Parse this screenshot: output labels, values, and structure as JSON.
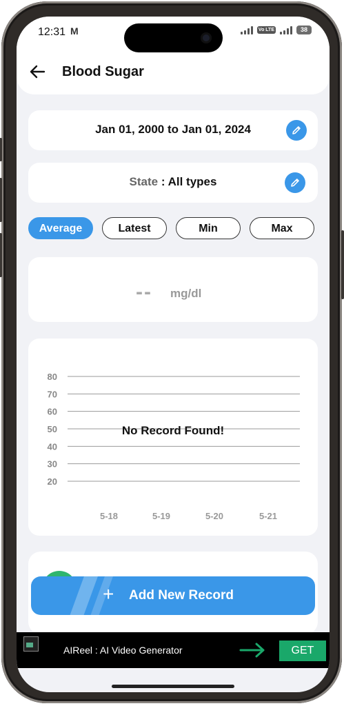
{
  "status_bar": {
    "time": "12:31",
    "mail_glyph": "M",
    "volte": "Vo LTE",
    "battery": "38"
  },
  "header": {
    "title": "Blood Sugar",
    "back_icon": "arrow-left"
  },
  "date_range": {
    "text": "Jan 01, 2000 to Jan 01, 2024",
    "edit_icon": "pencil"
  },
  "state": {
    "label": "State",
    "separator": " : ",
    "value": "All types",
    "edit_icon": "pencil"
  },
  "stat_tabs": [
    {
      "label": "Average",
      "active": true
    },
    {
      "label": "Latest",
      "active": false
    },
    {
      "label": "Min",
      "active": false
    },
    {
      "label": "Max",
      "active": false
    }
  ],
  "reading": {
    "value": "--",
    "unit": "mg/dl"
  },
  "chart_data": {
    "type": "line",
    "categories": [
      "5-18",
      "5-19",
      "5-20",
      "5-21"
    ],
    "series": [],
    "y_ticks": [
      80,
      70,
      60,
      50,
      40,
      30,
      20
    ],
    "ylim": [
      20,
      80
    ],
    "grid": true,
    "empty_message": "No Record Found!"
  },
  "add_button": {
    "label": "Add New Record",
    "icon": "plus"
  },
  "ad": {
    "title": "AIReel : AI Video Generator",
    "cta": "GET",
    "arrow_icon": "arrow-right"
  },
  "colors": {
    "accent": "#3a97e8",
    "ad_cta": "#1aa86a"
  }
}
